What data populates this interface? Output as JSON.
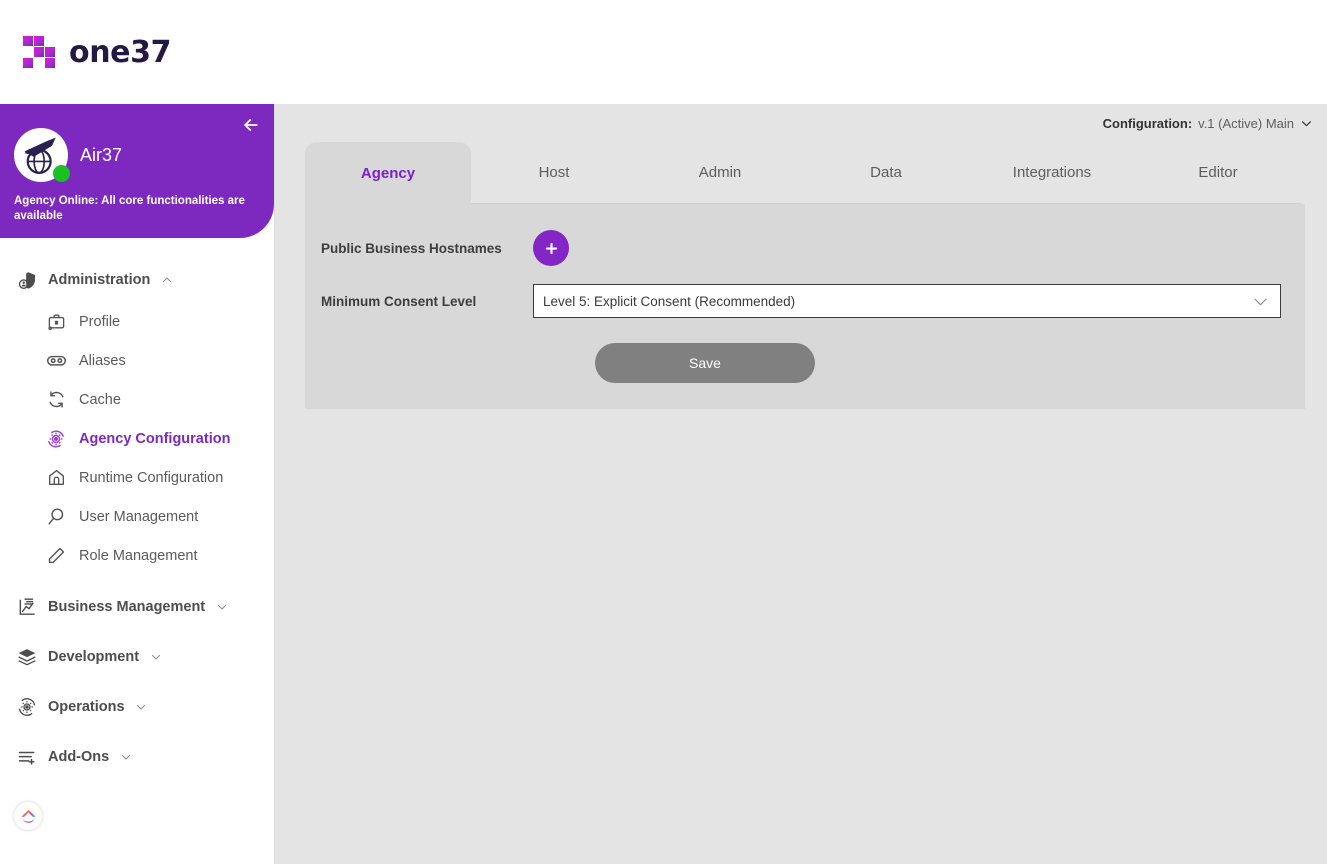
{
  "brand": {
    "name": "one37",
    "mark_icon": "one37-blocks-logo"
  },
  "sidebar": {
    "collapse_icon": "arrow-left-icon",
    "avatar_icon": "airplane-globe-avatar",
    "agency_name": "Air37",
    "status_text": "Agency Online: All core functionalities are available",
    "status_color": "#19c221",
    "header_color": "#7d29c0",
    "groups": [
      {
        "label": "Administration",
        "icon": "shield-user-icon",
        "expanded": true,
        "caret": "chevron-up-icon",
        "items": [
          {
            "label": "Profile",
            "icon": "briefcase-icon",
            "active": false
          },
          {
            "label": "Aliases",
            "icon": "chain-link-icon",
            "active": false
          },
          {
            "label": "Cache",
            "icon": "refresh-sync-icon",
            "active": false
          },
          {
            "label": "Agency Configuration",
            "icon": "gear-sync-icon",
            "active": true
          },
          {
            "label": "Runtime Configuration",
            "icon": "bank-building-icon",
            "active": false
          },
          {
            "label": "User Management",
            "icon": "user-search-icon",
            "active": false
          },
          {
            "label": "Role Management",
            "icon": "tag-label-icon",
            "active": false
          }
        ]
      },
      {
        "label": "Business Management",
        "icon": "chart-document-icon",
        "expanded": false,
        "caret": "chevron-down-icon",
        "items": []
      },
      {
        "label": "Development",
        "icon": "layers-stack-icon",
        "expanded": false,
        "caret": "chevron-down-icon",
        "items": []
      },
      {
        "label": "Operations",
        "icon": "gear-refresh-icon",
        "expanded": false,
        "caret": "chevron-down-icon",
        "items": []
      },
      {
        "label": "Add-Ons",
        "icon": "list-plus-icon",
        "expanded": false,
        "caret": "chevron-down-icon",
        "items": []
      }
    ],
    "footer_icon": "gradient-chevron-badge"
  },
  "main": {
    "config": {
      "label": "Configuration:",
      "value": "v.1 (Active) Main",
      "chevron_icon": "chevron-down-icon"
    },
    "tabs": [
      {
        "label": "Agency",
        "active": true
      },
      {
        "label": "Host",
        "active": false
      },
      {
        "label": "Admin",
        "active": false
      },
      {
        "label": "Data",
        "active": false
      },
      {
        "label": "Integrations",
        "active": false
      },
      {
        "label": "Editor",
        "active": false
      }
    ],
    "form": {
      "hostnames_label": "Public Business Hostnames",
      "add_button_icon": "plus-icon",
      "consent_label": "Minimum Consent Level",
      "consent_value": "Level 5: Explicit Consent (Recommended)",
      "consent_chevron_icon": "chevron-down-icon",
      "save_label": "Save"
    }
  },
  "colors": {
    "brand_purple": "#7d29c0",
    "accent_purple": "#8425c6",
    "active_tab_text": "#7d1fc9",
    "panel_bg": "#d8d8d8",
    "page_bg": "#e4e4e4",
    "online_green": "#19c221",
    "save_gray": "#808080"
  }
}
